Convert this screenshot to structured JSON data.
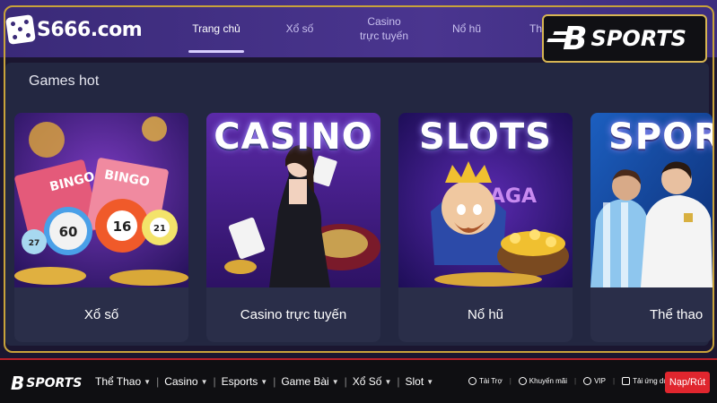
{
  "header": {
    "logo_text": "S666.com",
    "nav": [
      {
        "label": "Trang chủ"
      },
      {
        "label": "Xổ số"
      },
      {
        "label": "Casino\ntrực tuyến"
      },
      {
        "label": "Nổ hũ"
      },
      {
        "label": "Th"
      }
    ]
  },
  "badge": {
    "letter": "B",
    "word": "SPORTS"
  },
  "section": {
    "title": "Games hot",
    "cards": [
      {
        "label": "Xổ số",
        "ball_numbers": [
          "60",
          "16",
          "21",
          "27"
        ],
        "mini_text": "BINGO"
      },
      {
        "label": "Casino trực tuyến",
        "headline": "CASINO"
      },
      {
        "label": "Nổ hũ",
        "headline": "SLOTS",
        "sub": "SAGA"
      },
      {
        "label": "Thể thao",
        "headline": "SPORT"
      }
    ]
  },
  "bottom_bar": {
    "logo_letter": "B",
    "logo_word": "SPORTS",
    "menu": [
      "Thể Thao",
      "Casino",
      "Esports",
      "Game Bài",
      "Xổ Số",
      "Slot"
    ],
    "links": [
      "Tài Trợ",
      "Khuyến mãi",
      "VIP",
      "Tải ứng dụng"
    ],
    "cta": "Nạp/Rút"
  },
  "colors": {
    "accent_gold": "#c8a23a",
    "nav_bg": "#3a2a78",
    "cta_red": "#e0262e"
  }
}
